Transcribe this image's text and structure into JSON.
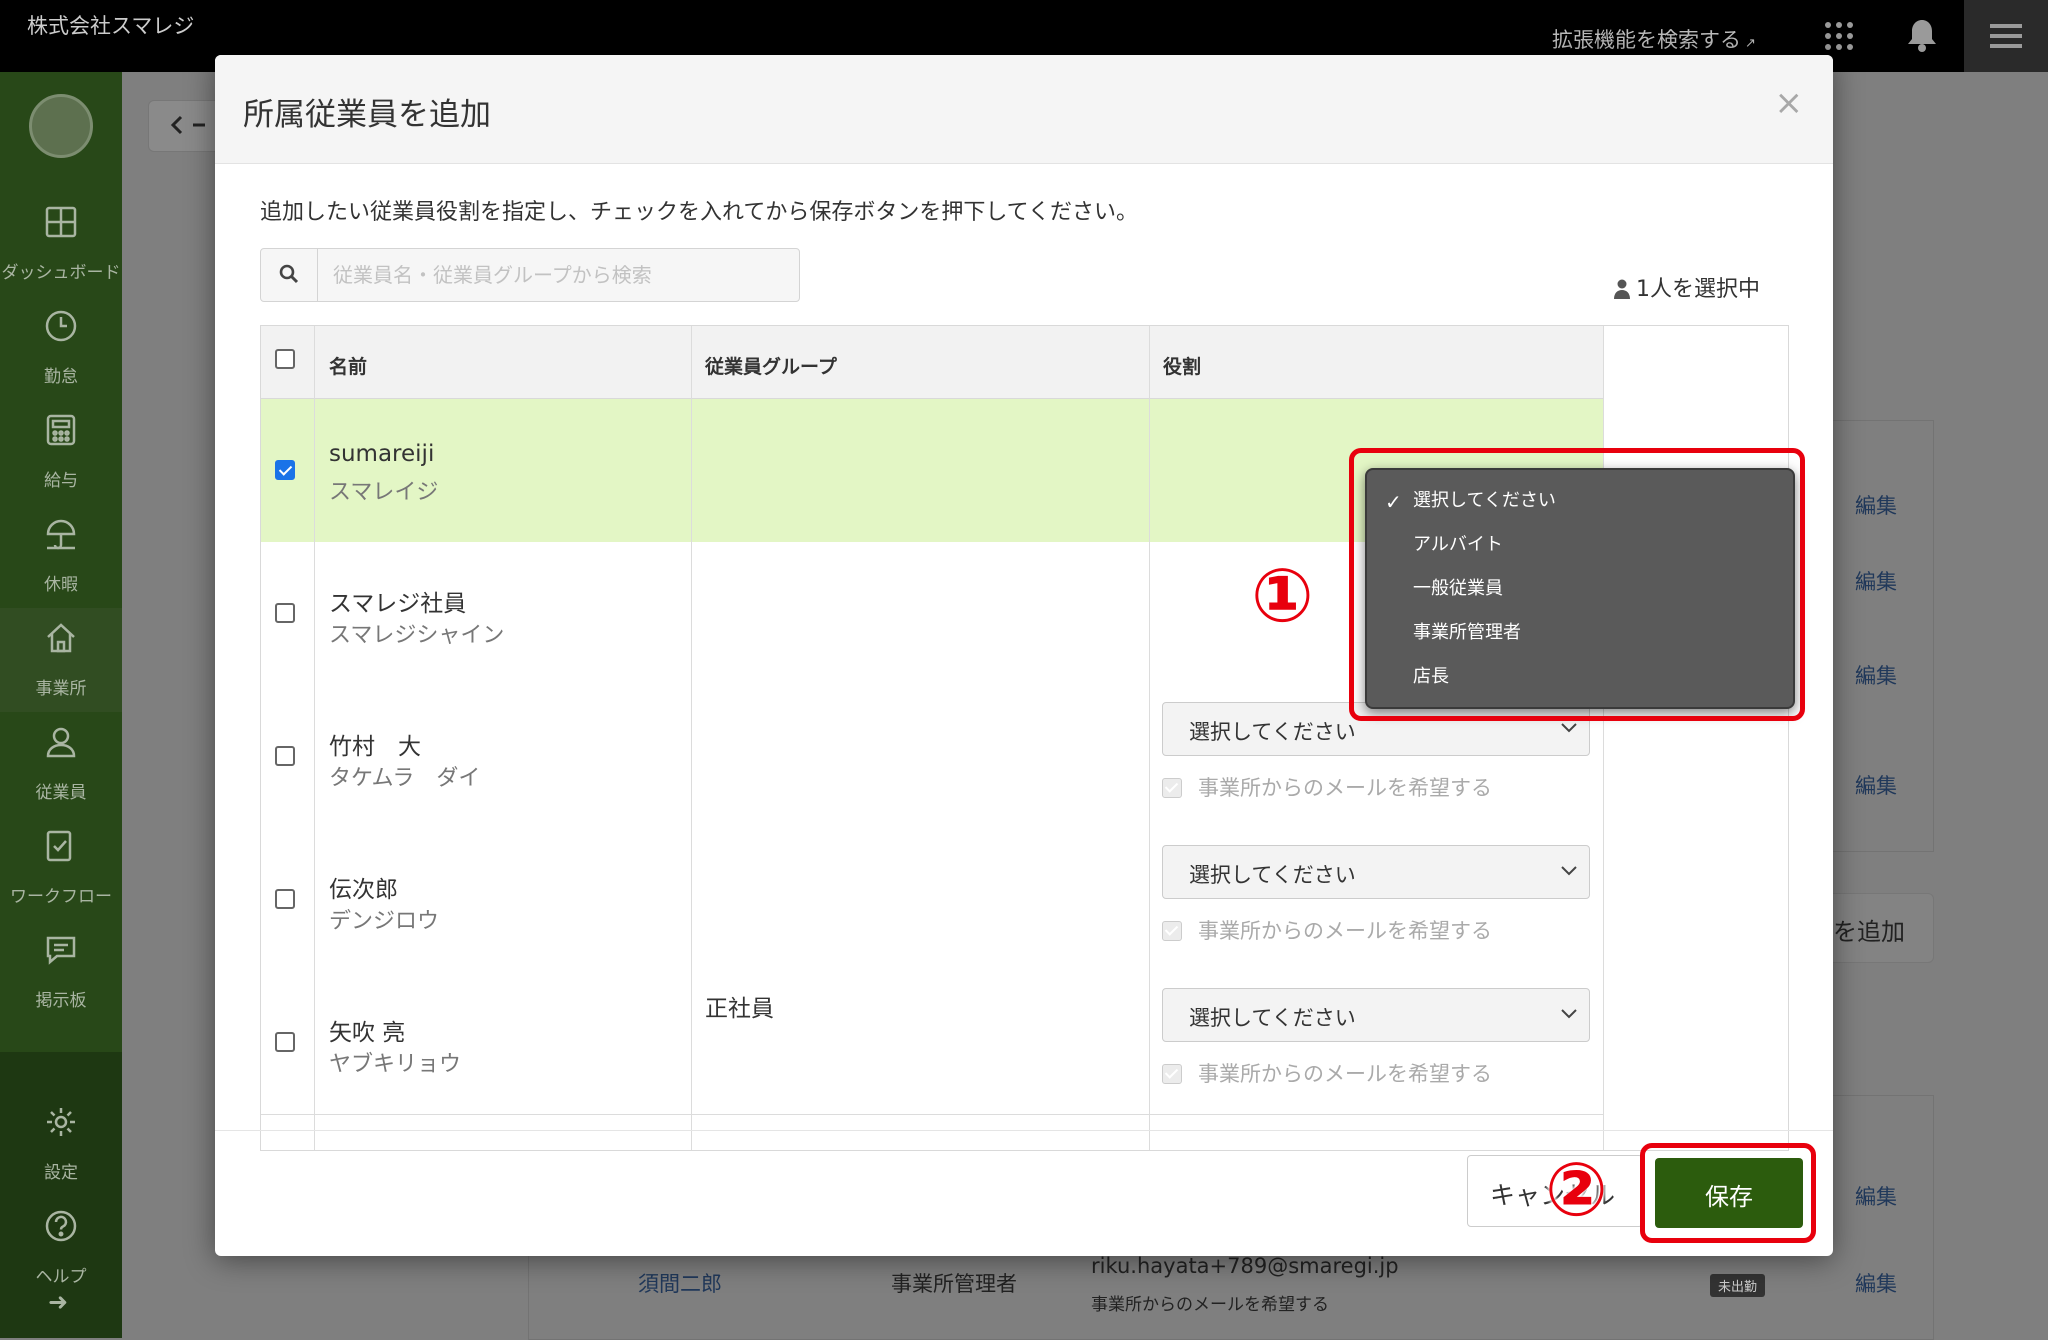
{
  "header": {
    "company": "株式会社スマレジ",
    "extension_search": "拡張機能を検索する",
    "apps_icon": "grid-icon",
    "bell_icon": "bell-icon",
    "menu_icon": "hamburger-icon"
  },
  "sidebar": {
    "items": [
      {
        "label": "ダッシュボード",
        "icon": "dashboard-icon"
      },
      {
        "label": "勤怠",
        "icon": "clock-icon"
      },
      {
        "label": "給与",
        "icon": "calculator-icon"
      },
      {
        "label": "休暇",
        "icon": "umbrella-icon"
      },
      {
        "label": "事業所",
        "icon": "home-icon"
      },
      {
        "label": "従業員",
        "icon": "person-icon"
      },
      {
        "label": "ワークフロー",
        "icon": "workflow-icon"
      },
      {
        "label": "掲示板",
        "icon": "board-icon"
      },
      {
        "label": "設定",
        "icon": "gear-icon"
      },
      {
        "label": "ヘルプ",
        "icon": "help-icon"
      }
    ],
    "active": "事業所"
  },
  "background": {
    "edit_label": "編集",
    "add_button_label": "を追加",
    "row": {
      "name": "須間二郎",
      "role": "事業所管理者",
      "email": "riku.hayata+789@smaregi.jp",
      "note": "事業所からのメールを希望する",
      "badge": "未出勤"
    }
  },
  "modal": {
    "title": "所属従業員を追加",
    "close": "×",
    "instruction": "追加したい従業員役割を指定し、チェックを入れてから保存ボタンを押下してください。",
    "search_placeholder": "従業員名・従業員グループから検索",
    "selected_count": "1人を選択中",
    "columns": {
      "name": "名前",
      "group": "従業員グループ",
      "role": "役割"
    },
    "rows": [
      {
        "name": "sumareiji",
        "kana": "スマレイジ",
        "group": "",
        "checked": true
      },
      {
        "name": "スマレジ社員",
        "kana": "スマレジシャイン",
        "group": "",
        "checked": false
      },
      {
        "name": "竹村　大",
        "kana": "タケムラ　ダイ",
        "group": "",
        "checked": false,
        "role": "選択してください",
        "mail": "事業所からのメールを希望する"
      },
      {
        "name": "伝次郎",
        "kana": "デンジロウ",
        "group": "",
        "checked": false,
        "role": "選択してください",
        "mail": "事業所からのメールを希望する"
      },
      {
        "name": "矢吹 亮",
        "kana": "ヤブキリョウ",
        "group": "正社員",
        "checked": false,
        "role": "選択してください",
        "mail": "事業所からのメールを希望する"
      }
    ],
    "dropdown": {
      "options": [
        "選択してください",
        "アルバイト",
        "一般従業員",
        "事業所管理者",
        "店長"
      ],
      "selected": "選択してください"
    },
    "cancel_label": "キャンセル",
    "save_label": "保存",
    "annotations": [
      "①",
      "②"
    ],
    "annotation_color": "#e8000d"
  }
}
